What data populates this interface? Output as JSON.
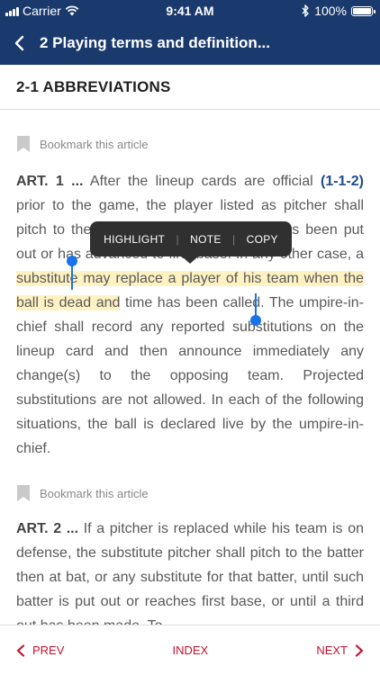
{
  "status_bar": {
    "carrier": "Carrier",
    "time": "9:41 AM",
    "battery": "100%",
    "bluetooth_icon": "bluetooth-icon",
    "battery_level": 1.0
  },
  "nav": {
    "title": "2 Playing terms and definition...",
    "back_icon": "chevron-left-icon"
  },
  "section": {
    "title": "2-1 ABBREVIATIONS"
  },
  "articles": [
    {
      "bookmark_label": "Bookmark this article",
      "label": "ART. 1 ...",
      "text_a": " After the lineup cards are official ",
      "ref": "(1-1-2)",
      "text_b": " prior to the game, the player listed as pitcher shall pitch to the first batter until that batter has been put out or has advanced to first base. In any other case, a ",
      "highlighted": "substitute may replace a player of his team when the ball is dead and",
      "text_c": " time has been called. The umpire-in-chief shall record any reported substitutions on the lineup card and then announce immediately any change(s) to the opposing team. Projected substitutions are not allowed. In each of the following situations, the ball is declared live by the umpire-in-chief."
    },
    {
      "bookmark_label": "Bookmark this article",
      "label": "ART. 2 ...",
      "text": " If a pitcher is replaced while his team is on defense, the substitute pitcher shall pitch to the batter then at bat, or any substitute for that batter, until such batter is put out or reaches first base, or until a third out has been made. To"
    }
  ],
  "popover": {
    "highlight": "HIGHLIGHT",
    "note": "NOTE",
    "copy": "COPY"
  },
  "bottom_bar": {
    "prev": "PREV",
    "index": "INDEX",
    "next": "NEXT"
  },
  "colors": {
    "nav_bg": "#1a3a6e",
    "accent_red": "#c8102e",
    "selection_blue": "#1a73e8",
    "highlight": "#fff2c2",
    "link_blue": "#1f4e8c"
  }
}
